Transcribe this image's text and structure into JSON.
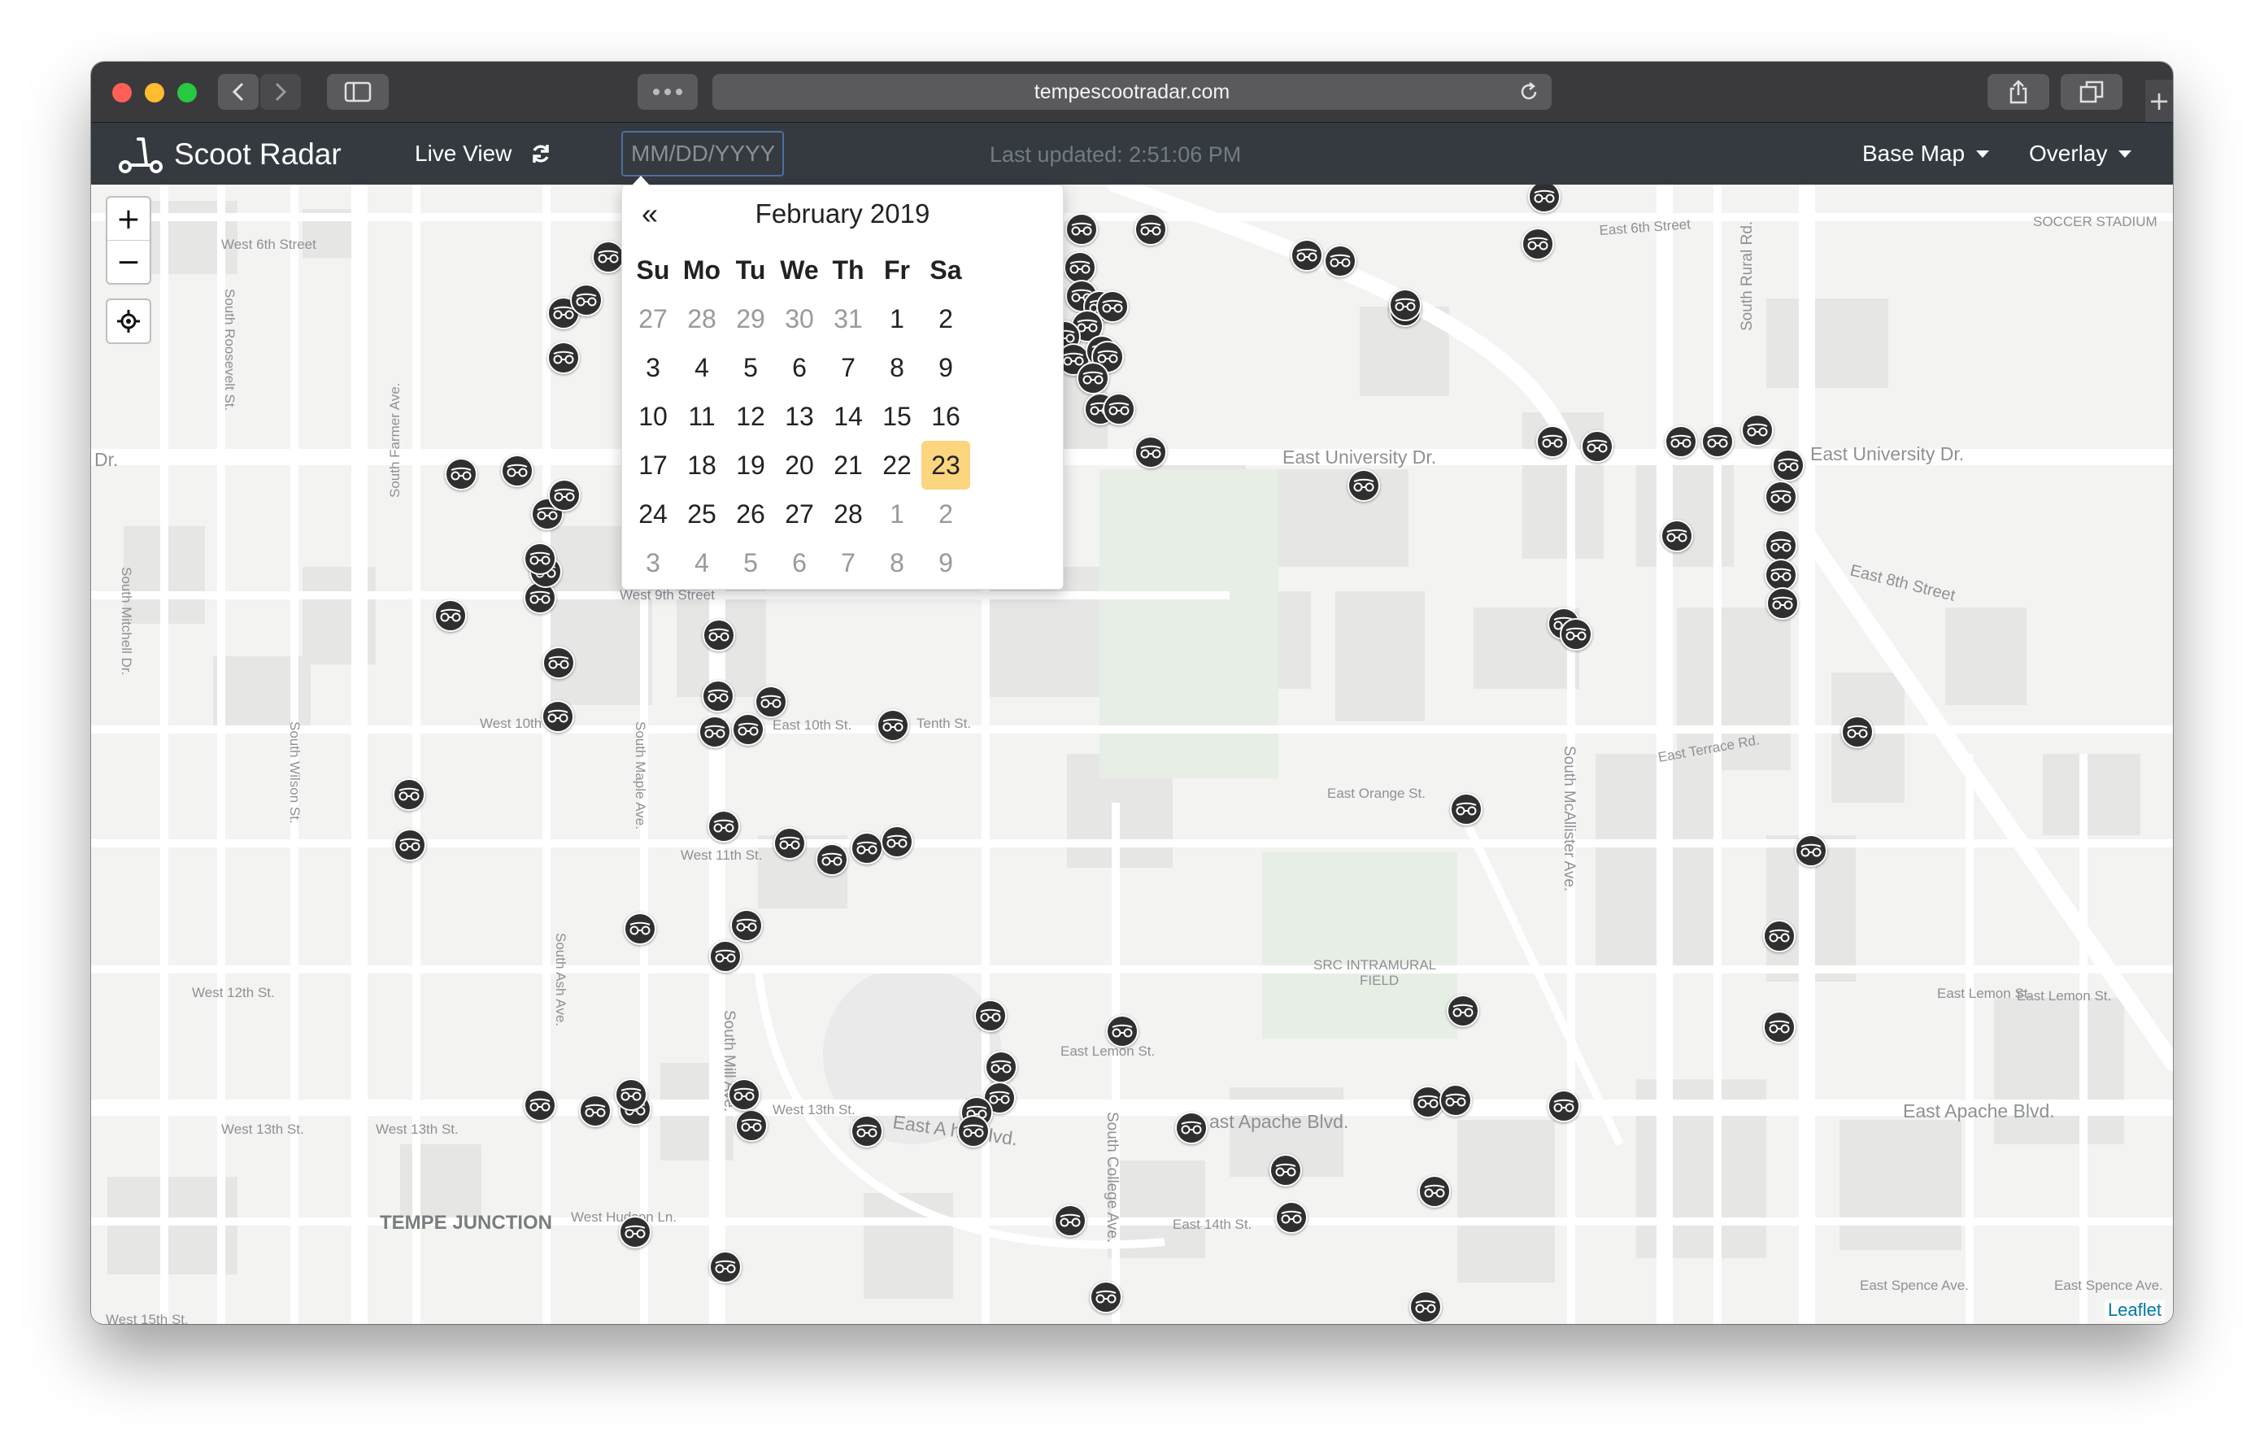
{
  "browser": {
    "url": "tempescootradar.com",
    "new_tab_label": "+"
  },
  "navbar": {
    "brand": "Scoot Radar",
    "live_view": "Live View",
    "date_placeholder": "MM/DD/YYYY",
    "last_updated": "Last updated: 2:51:06 PM",
    "base_map": "Base Map",
    "overlay": "Overlay"
  },
  "map": {
    "zoom_in": "+",
    "zoom_out": "−",
    "attribution": "Leaflet",
    "labels": {
      "tempe_junction": "TEMPE JUNCTION",
      "src_field_1": "SRC INTRAMURAL",
      "src_field_2": "FIELD",
      "soccer": "SOCCER STADIUM",
      "univ_dr_east": "East University Dr.",
      "univ_dr_east2": "East University Dr.",
      "apache_east": "East Apache Blvd.",
      "apache_mid": "ast Apache Blvd.",
      "apache_west": "East A   he Blvd.",
      "west_6th": "West 6th Street",
      "east_6th": "East 6th Street",
      "east_8th": "East 8th Street",
      "west_9th": "West 9th Street",
      "west_10th": "West 10th St.",
      "tenth": "Tenth St.",
      "east_10th": "East 10th St.",
      "west_11th": "West 11th St.",
      "west_12th": "West 12th St.",
      "west_13th_a": "West 13th St.",
      "west_13th_b": "West 13th St.",
      "w_13th": "West 13th St.",
      "east_14th": "East 14th St.",
      "west_hudson": "West Hudson Ln.",
      "east_lemon": "East Lemon St.",
      "east_lemon2": "East Lemon St.",
      "east_lemon3": "East Lemon St.",
      "east_orange": "East Orange St.",
      "east_terrace": "East Terrace Rd.",
      "east_spence": "East Spence Ave.",
      "east_spence2": "East Spence Ave.",
      "dr_left": "Dr.",
      "mcallister": "South McAllister Ave.",
      "rural": "South Rural Rd.",
      "college": "South College Ave.",
      "mill": "South Mill Ave.",
      "farmer": "South Farmer Ave.",
      "roosevelt": "South Roosevelt St.",
      "ash": "South Ash Ave.",
      "maple": "South Maple Ave.",
      "wilson": "South Wilson St.",
      "mitchell": "South Mitchell Dr.",
      "west_15th": "West 15th St."
    }
  },
  "datepicker": {
    "prev": "«",
    "title": "February 2019",
    "weekdays": [
      "Su",
      "Mo",
      "Tu",
      "We",
      "Th",
      "Fr",
      "Sa"
    ],
    "weeks": [
      [
        "27",
        "28",
        "29",
        "30",
        "31",
        "1",
        "2"
      ],
      [
        "3",
        "4",
        "5",
        "6",
        "7",
        "8",
        "9"
      ],
      [
        "10",
        "11",
        "12",
        "13",
        "14",
        "15",
        "16"
      ],
      [
        "17",
        "18",
        "19",
        "20",
        "21",
        "22",
        "23"
      ],
      [
        "24",
        "25",
        "26",
        "27",
        "28",
        "1",
        "2"
      ],
      [
        "3",
        "4",
        "5",
        "6",
        "7",
        "8",
        "9"
      ]
    ],
    "selected": "23"
  },
  "colors": {
    "navbar": "#343a40",
    "pin": "#2f2f2f",
    "today_highlight": "#fcd57f",
    "link": "#0078a8"
  }
}
